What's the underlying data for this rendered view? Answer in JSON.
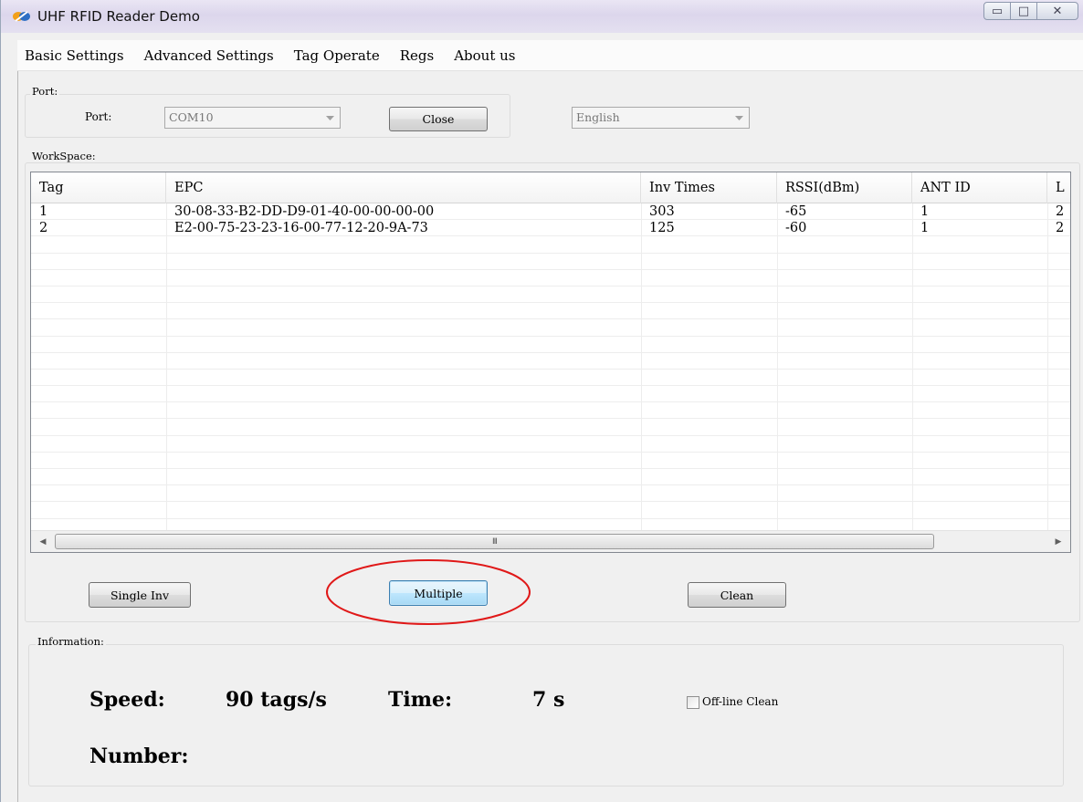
{
  "window": {
    "title": "UHF RFID Reader Demo",
    "minimize_glyph": "▭",
    "maximize_glyph": "□",
    "close_glyph": "✕"
  },
  "menu": [
    "Basic Settings",
    "Advanced Settings",
    "Tag Operate",
    "Regs",
    "About us"
  ],
  "port_group": {
    "legend": "Port:",
    "port_label": "Port:",
    "port_value": "COM10",
    "close_button": "Close",
    "language_value": "English"
  },
  "workspace": {
    "legend": "WorkSpace:",
    "columns": [
      "Tag",
      "EPC",
      "Inv Times",
      "RSSI(dBm)",
      "ANT ID",
      "L"
    ],
    "rows": [
      [
        "1",
        "30-08-33-B2-DD-D9-01-40-00-00-00-00",
        "303",
        "-65",
        "1",
        "2"
      ],
      [
        "2",
        "E2-00-75-23-23-16-00-77-12-20-9A-73",
        "125",
        "-60",
        "1",
        "2"
      ]
    ],
    "scroll_grip": "III",
    "single_inv_button": "Single Inv",
    "multiple_button": "Multiple",
    "clean_button": "Clean"
  },
  "information": {
    "legend": "Information:",
    "speed_label": "Speed:",
    "speed_value": "90 tags/s",
    "time_label": "Time:",
    "time_value": "7 s",
    "offline_clean_label": "Off-line Clean",
    "number_label": "Number:"
  },
  "colors": {
    "annotation": "#e01818",
    "focus_border": "#3c7fb1"
  }
}
